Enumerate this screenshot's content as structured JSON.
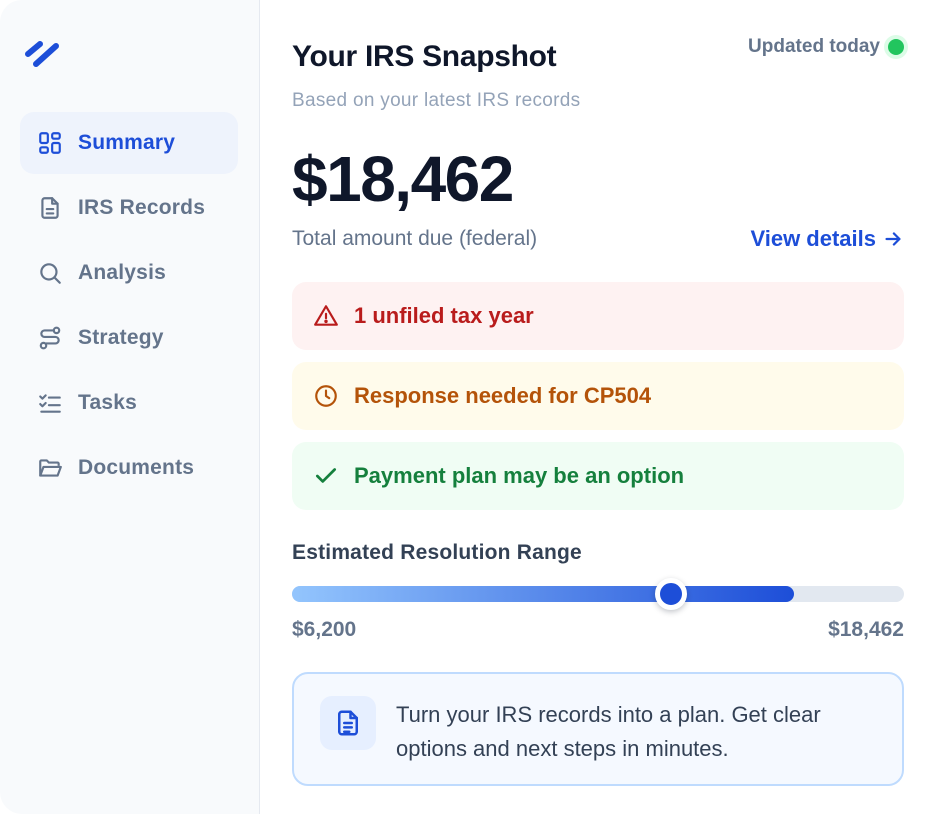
{
  "colors": {
    "accent": "#1d4ed8",
    "muted": "#64748b",
    "alert_red": "#b91c1c",
    "alert_amber": "#b45309",
    "alert_green": "#15803d",
    "status_green": "#22c55e"
  },
  "sidebar": {
    "logo_icon": "brand-double-slash-icon",
    "items": [
      {
        "label": "Summary",
        "icon": "dashboard-grid-icon",
        "active": true
      },
      {
        "label": "IRS Records",
        "icon": "document-icon",
        "active": false
      },
      {
        "label": "Analysis",
        "icon": "search-icon",
        "active": false
      },
      {
        "label": "Strategy",
        "icon": "route-icon",
        "active": false
      },
      {
        "label": "Tasks",
        "icon": "checklist-icon",
        "active": false
      },
      {
        "label": "Documents",
        "icon": "folder-open-icon",
        "active": false
      }
    ]
  },
  "header": {
    "title": "Your IRS Snapshot",
    "subtitle": "Based on your latest IRS records",
    "status_text": "Updated today"
  },
  "summary": {
    "amount": "$18,462",
    "amount_label": "Total amount due (federal)",
    "view_details_label": "View details"
  },
  "alerts": [
    {
      "text": "1 unfiled tax year",
      "icon": "warning-triangle-icon",
      "tone": "red"
    },
    {
      "text": "Response needed for CP504",
      "icon": "clock-icon",
      "tone": "amber"
    },
    {
      "text": "Payment plan may be an option",
      "icon": "check-icon",
      "tone": "green"
    }
  ],
  "range": {
    "title": "Estimated Resolution Range",
    "min_label": "$6,200",
    "max_label": "$18,462",
    "fill_fraction": 0.82,
    "thumb_fraction": 0.62
  },
  "promo": {
    "icon": "document-lines-icon",
    "text": "Turn your IRS records into a plan. Get clear options and next steps in minutes."
  }
}
